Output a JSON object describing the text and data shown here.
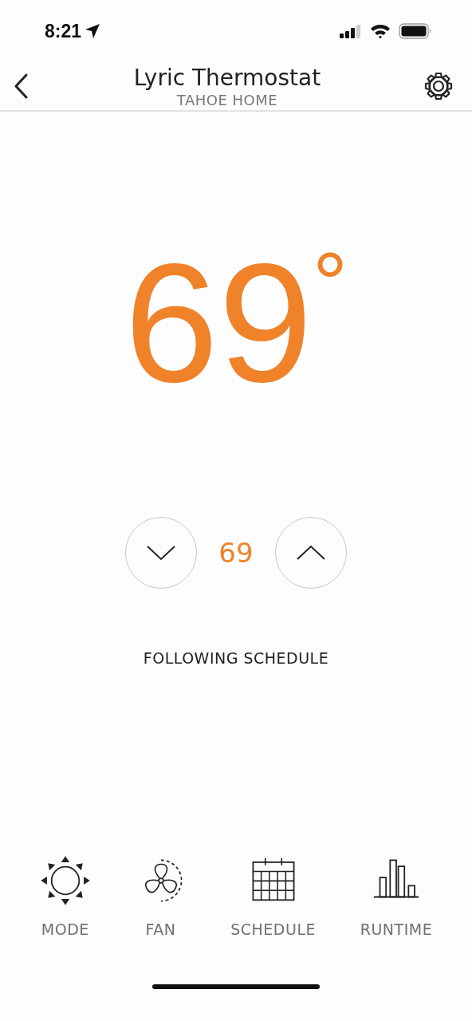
{
  "status_bar": {
    "time": "8:21"
  },
  "header": {
    "title": "Lyric Thermostat",
    "subtitle": "TAHOE HOME"
  },
  "temperature": {
    "current": "69",
    "unit": "°"
  },
  "setpoint": {
    "value": "69"
  },
  "status": "FOLLOWING SCHEDULE",
  "nav": [
    {
      "kind": "mode",
      "label": "MODE"
    },
    {
      "kind": "fan",
      "label": "FAN"
    },
    {
      "kind": "schedule",
      "label": "SCHEDULE"
    },
    {
      "kind": "runtime",
      "label": "RUNTIME"
    }
  ]
}
